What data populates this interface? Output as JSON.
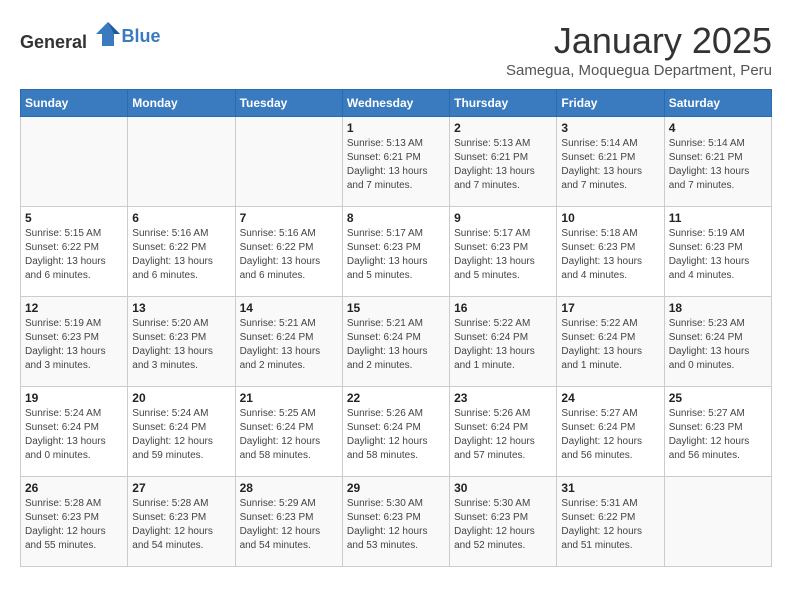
{
  "header": {
    "logo_general": "General",
    "logo_blue": "Blue",
    "month_title": "January 2025",
    "subtitle": "Samegua, Moquegua Department, Peru"
  },
  "weekdays": [
    "Sunday",
    "Monday",
    "Tuesday",
    "Wednesday",
    "Thursday",
    "Friday",
    "Saturday"
  ],
  "weeks": [
    [
      {
        "day": "",
        "sunrise": "",
        "sunset": "",
        "daylight": ""
      },
      {
        "day": "",
        "sunrise": "",
        "sunset": "",
        "daylight": ""
      },
      {
        "day": "",
        "sunrise": "",
        "sunset": "",
        "daylight": ""
      },
      {
        "day": "1",
        "sunrise": "Sunrise: 5:13 AM",
        "sunset": "Sunset: 6:21 PM",
        "daylight": "Daylight: 13 hours and 7 minutes."
      },
      {
        "day": "2",
        "sunrise": "Sunrise: 5:13 AM",
        "sunset": "Sunset: 6:21 PM",
        "daylight": "Daylight: 13 hours and 7 minutes."
      },
      {
        "day": "3",
        "sunrise": "Sunrise: 5:14 AM",
        "sunset": "Sunset: 6:21 PM",
        "daylight": "Daylight: 13 hours and 7 minutes."
      },
      {
        "day": "4",
        "sunrise": "Sunrise: 5:14 AM",
        "sunset": "Sunset: 6:21 PM",
        "daylight": "Daylight: 13 hours and 7 minutes."
      }
    ],
    [
      {
        "day": "5",
        "sunrise": "Sunrise: 5:15 AM",
        "sunset": "Sunset: 6:22 PM",
        "daylight": "Daylight: 13 hours and 6 minutes."
      },
      {
        "day": "6",
        "sunrise": "Sunrise: 5:16 AM",
        "sunset": "Sunset: 6:22 PM",
        "daylight": "Daylight: 13 hours and 6 minutes."
      },
      {
        "day": "7",
        "sunrise": "Sunrise: 5:16 AM",
        "sunset": "Sunset: 6:22 PM",
        "daylight": "Daylight: 13 hours and 6 minutes."
      },
      {
        "day": "8",
        "sunrise": "Sunrise: 5:17 AM",
        "sunset": "Sunset: 6:23 PM",
        "daylight": "Daylight: 13 hours and 5 minutes."
      },
      {
        "day": "9",
        "sunrise": "Sunrise: 5:17 AM",
        "sunset": "Sunset: 6:23 PM",
        "daylight": "Daylight: 13 hours and 5 minutes."
      },
      {
        "day": "10",
        "sunrise": "Sunrise: 5:18 AM",
        "sunset": "Sunset: 6:23 PM",
        "daylight": "Daylight: 13 hours and 4 minutes."
      },
      {
        "day": "11",
        "sunrise": "Sunrise: 5:19 AM",
        "sunset": "Sunset: 6:23 PM",
        "daylight": "Daylight: 13 hours and 4 minutes."
      }
    ],
    [
      {
        "day": "12",
        "sunrise": "Sunrise: 5:19 AM",
        "sunset": "Sunset: 6:23 PM",
        "daylight": "Daylight: 13 hours and 3 minutes."
      },
      {
        "day": "13",
        "sunrise": "Sunrise: 5:20 AM",
        "sunset": "Sunset: 6:23 PM",
        "daylight": "Daylight: 13 hours and 3 minutes."
      },
      {
        "day": "14",
        "sunrise": "Sunrise: 5:21 AM",
        "sunset": "Sunset: 6:24 PM",
        "daylight": "Daylight: 13 hours and 2 minutes."
      },
      {
        "day": "15",
        "sunrise": "Sunrise: 5:21 AM",
        "sunset": "Sunset: 6:24 PM",
        "daylight": "Daylight: 13 hours and 2 minutes."
      },
      {
        "day": "16",
        "sunrise": "Sunrise: 5:22 AM",
        "sunset": "Sunset: 6:24 PM",
        "daylight": "Daylight: 13 hours and 1 minute."
      },
      {
        "day": "17",
        "sunrise": "Sunrise: 5:22 AM",
        "sunset": "Sunset: 6:24 PM",
        "daylight": "Daylight: 13 hours and 1 minute."
      },
      {
        "day": "18",
        "sunrise": "Sunrise: 5:23 AM",
        "sunset": "Sunset: 6:24 PM",
        "daylight": "Daylight: 13 hours and 0 minutes."
      }
    ],
    [
      {
        "day": "19",
        "sunrise": "Sunrise: 5:24 AM",
        "sunset": "Sunset: 6:24 PM",
        "daylight": "Daylight: 13 hours and 0 minutes."
      },
      {
        "day": "20",
        "sunrise": "Sunrise: 5:24 AM",
        "sunset": "Sunset: 6:24 PM",
        "daylight": "Daylight: 12 hours and 59 minutes."
      },
      {
        "day": "21",
        "sunrise": "Sunrise: 5:25 AM",
        "sunset": "Sunset: 6:24 PM",
        "daylight": "Daylight: 12 hours and 58 minutes."
      },
      {
        "day": "22",
        "sunrise": "Sunrise: 5:26 AM",
        "sunset": "Sunset: 6:24 PM",
        "daylight": "Daylight: 12 hours and 58 minutes."
      },
      {
        "day": "23",
        "sunrise": "Sunrise: 5:26 AM",
        "sunset": "Sunset: 6:24 PM",
        "daylight": "Daylight: 12 hours and 57 minutes."
      },
      {
        "day": "24",
        "sunrise": "Sunrise: 5:27 AM",
        "sunset": "Sunset: 6:24 PM",
        "daylight": "Daylight: 12 hours and 56 minutes."
      },
      {
        "day": "25",
        "sunrise": "Sunrise: 5:27 AM",
        "sunset": "Sunset: 6:23 PM",
        "daylight": "Daylight: 12 hours and 56 minutes."
      }
    ],
    [
      {
        "day": "26",
        "sunrise": "Sunrise: 5:28 AM",
        "sunset": "Sunset: 6:23 PM",
        "daylight": "Daylight: 12 hours and 55 minutes."
      },
      {
        "day": "27",
        "sunrise": "Sunrise: 5:28 AM",
        "sunset": "Sunset: 6:23 PM",
        "daylight": "Daylight: 12 hours and 54 minutes."
      },
      {
        "day": "28",
        "sunrise": "Sunrise: 5:29 AM",
        "sunset": "Sunset: 6:23 PM",
        "daylight": "Daylight: 12 hours and 54 minutes."
      },
      {
        "day": "29",
        "sunrise": "Sunrise: 5:30 AM",
        "sunset": "Sunset: 6:23 PM",
        "daylight": "Daylight: 12 hours and 53 minutes."
      },
      {
        "day": "30",
        "sunrise": "Sunrise: 5:30 AM",
        "sunset": "Sunset: 6:23 PM",
        "daylight": "Daylight: 12 hours and 52 minutes."
      },
      {
        "day": "31",
        "sunrise": "Sunrise: 5:31 AM",
        "sunset": "Sunset: 6:22 PM",
        "daylight": "Daylight: 12 hours and 51 minutes."
      },
      {
        "day": "",
        "sunrise": "",
        "sunset": "",
        "daylight": ""
      }
    ]
  ]
}
